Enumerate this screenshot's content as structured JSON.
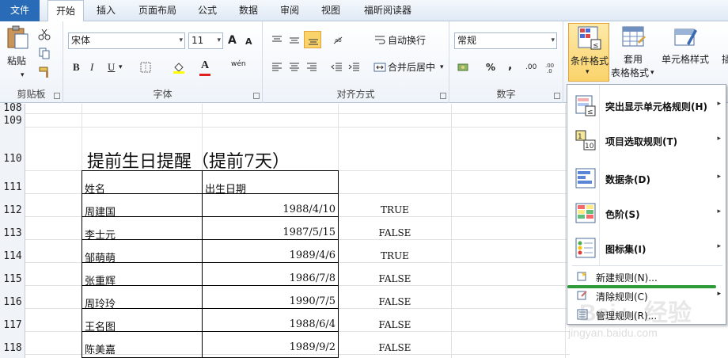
{
  "tabs": [
    "文件",
    "开始",
    "插入",
    "页面布局",
    "公式",
    "数据",
    "审阅",
    "视图",
    "福昕阅读器"
  ],
  "clipboard": {
    "paste_label": "粘贴",
    "group_label": "剪贴板"
  },
  "font": {
    "font_name": "宋体",
    "font_size": "11",
    "group_label": "字体",
    "bold": "B",
    "italic": "I",
    "underline": "U",
    "font_color_letter": "A",
    "grow": "A",
    "shrink": "A",
    "wen": "wén"
  },
  "alignment": {
    "wrap_label": "自动换行",
    "merge_label": "合并后居中",
    "group_label": "对齐方式"
  },
  "number": {
    "format_value": "常规",
    "percent": "%",
    "comma": ",",
    "inc": ".00",
    "group_label": "数字"
  },
  "styles": {
    "cond_format_label": "条件格式",
    "table_format_label1": "套用",
    "table_format_label2": "表格格式",
    "cell_style_label": "单元格样式",
    "insert_label": "插"
  },
  "row_numbers": [
    "108",
    "109",
    "110",
    "111",
    "112",
    "113",
    "114",
    "115",
    "116",
    "117",
    "118"
  ],
  "sheet": {
    "title": "提前生日提醒（提前7天）",
    "headers": [
      "姓名",
      "出生日期"
    ],
    "rows": [
      {
        "name": "周建国",
        "date": "1988/4/10",
        "flag": "TRUE"
      },
      {
        "name": "李士元",
        "date": "1987/5/15",
        "flag": "FALSE"
      },
      {
        "name": "邹萌萌",
        "date": "1989/4/6",
        "flag": "TRUE"
      },
      {
        "name": "张重辉",
        "date": "1986/7/8",
        "flag": "FALSE"
      },
      {
        "name": "周玲玲",
        "date": "1990/7/5",
        "flag": "FALSE"
      },
      {
        "name": "王名图",
        "date": "1988/6/4",
        "flag": "FALSE"
      },
      {
        "name": "陈美嘉",
        "date": "1989/9/2",
        "flag": "FALSE"
      }
    ]
  },
  "menu": {
    "items": [
      {
        "label": "突出显示单元格规则(H)",
        "icon": "highlight-rules-icon"
      },
      {
        "label": "项目选取规则(T)",
        "icon": "top-bottom-rules-icon"
      },
      {
        "label": "数据条(D)",
        "icon": "data-bars-icon"
      },
      {
        "label": "色阶(S)",
        "icon": "color-scales-icon"
      },
      {
        "label": "图标集(I)",
        "icon": "icon-sets-icon"
      }
    ],
    "new_rule": "新建规则(N)...",
    "clear_rules": "清除规则(C)",
    "manage_rules": "管理规则(R)..."
  },
  "colors": {
    "file_tab": "#2a6bb8",
    "highlight_line": "#2e9a3a",
    "active_button": "#fbd36b"
  },
  "watermark": "jingyan.baidu.com"
}
